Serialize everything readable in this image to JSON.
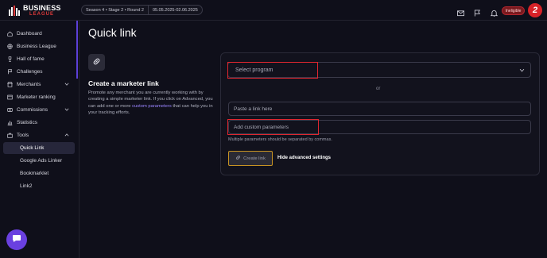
{
  "brand": {
    "line1": "BUSINESS",
    "line2": "LEAGUE"
  },
  "season": {
    "stage": "Season 4 • Stage 2 • Round 2",
    "dates": "05.05.2025-02.06.2025"
  },
  "header": {
    "status_badge": "Ineligible",
    "icons": [
      "mail-icon",
      "flag-icon",
      "bell-icon"
    ]
  },
  "sidebar": {
    "items": [
      {
        "label": "Dashboard",
        "icon": "home-icon"
      },
      {
        "label": "Business League",
        "icon": "globe-icon"
      },
      {
        "label": "Hall of fame",
        "icon": "trophy-icon"
      },
      {
        "label": "Challenges",
        "icon": "challenge-icon"
      },
      {
        "label": "Merchants",
        "icon": "store-icon",
        "expandable": true
      },
      {
        "label": "Marketer ranking",
        "icon": "ranking-icon"
      },
      {
        "label": "Commissions",
        "icon": "coins-icon",
        "expandable": true
      },
      {
        "label": "Statistics",
        "icon": "stats-icon"
      },
      {
        "label": "Tools",
        "icon": "tools-icon",
        "expandable": true,
        "expanded": true
      }
    ],
    "tools_subitems": [
      {
        "label": "Quick Link",
        "active": true
      },
      {
        "label": "Google Ads Linker"
      },
      {
        "label": "Bookmarklet"
      },
      {
        "label": "Link2"
      }
    ]
  },
  "main": {
    "title": "Quick link",
    "heading": "Create a marketer link",
    "description_before": "Promote any merchant you are currently working with by creating a simple marketer link. If you click on Advanced, you can add one or more ",
    "description_link": "custom parameters",
    "description_after": " that can help you in your tracking efforts.",
    "select_placeholder": "Select program",
    "or_label": "or",
    "paste_placeholder": "Paste a link here",
    "params_placeholder": "Add custom parameters",
    "params_hint": "Multiple parameters should be separated by commas.",
    "create_button": "Create link",
    "toggle_advanced": "Hide advanced settings"
  },
  "colors": {
    "accent": "#6a40e0",
    "highlight_red": "#e0262f",
    "highlight_gold": "#c79322",
    "background": "#0f0f1a"
  }
}
